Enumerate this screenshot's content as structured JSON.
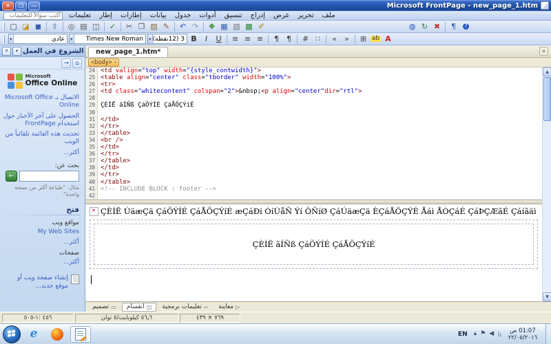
{
  "window": {
    "title": "Microsoft FrontPage - new_page_1.htm",
    "controls": {
      "close": "✕",
      "maximize": "❐",
      "minimize": "—"
    }
  },
  "icons": {
    "dropdown": "▾",
    "scroll_up": "▲",
    "scroll_down": "▼",
    "close": "✕",
    "home": "⌂",
    "back": "→",
    "go_arrow": "←"
  },
  "menu_bar": {
    "question_placeholder": "اكتب سؤالاً للتعليمات",
    "items": [
      {
        "label": "تعليمات"
      },
      {
        "label": "إطار"
      },
      {
        "label": "إطارات"
      },
      {
        "label": "بيانات"
      },
      {
        "label": "جدول"
      },
      {
        "label": "أدوات"
      },
      {
        "label": "تنسيق"
      },
      {
        "label": "إدراج"
      },
      {
        "label": "عرض"
      },
      {
        "label": "تحرير"
      },
      {
        "label": "ملف"
      }
    ]
  },
  "toolbar_standard": [
    {
      "n": "new-page-icon",
      "g": "▢",
      "c": "#4a4a4a"
    },
    {
      "n": "open-folder-icon",
      "g": "◪",
      "c": "#c8931c"
    },
    {
      "n": "save-icon",
      "g": "◼",
      "c": "#3a5fae",
      "sep": true
    },
    {
      "n": "publish-site-icon",
      "g": "⇧",
      "c": "#3a5fae",
      "sep": true
    },
    {
      "n": "search-icon",
      "g": "◎",
      "c": "#555555"
    },
    {
      "n": "print-icon",
      "g": "▤",
      "c": "#555555"
    },
    {
      "n": "print-preview-icon",
      "g": "◫",
      "c": "#555555",
      "sep": true
    },
    {
      "n": "spelling-icon",
      "g": "✓",
      "c": "#2e7d32",
      "sep": true
    },
    {
      "n": "cut-icon",
      "g": "✂",
      "c": "#555555"
    },
    {
      "n": "copy-icon",
      "g": "❐",
      "c": "#555555"
    },
    {
      "n": "paste-icon",
      "g": "▨",
      "c": "#8a6d3b"
    },
    {
      "n": "format-painter-icon",
      "g": "✎",
      "c": "#a05a2c",
      "sep": true
    },
    {
      "n": "undo-icon",
      "g": "↶",
      "c": "#2a56c6"
    },
    {
      "n": "redo-icon",
      "g": "↷",
      "c": "#8a9ab8",
      "sep": true
    },
    {
      "n": "web-component-icon",
      "g": "❖",
      "c": "#2a8a2a"
    },
    {
      "n": "insert-table-icon",
      "g": "▦",
      "c": "#3a5fae"
    },
    {
      "n": "insert-layer-icon",
      "g": "▧",
      "c": "#777777"
    },
    {
      "n": "insert-picture-icon",
      "g": "▩",
      "c": "#2a8a2a"
    },
    {
      "n": "drawing-icon",
      "g": "✐",
      "c": "#b8860b",
      "gap": 200
    },
    {
      "n": "hyperlink-icon",
      "g": "◍",
      "c": "#2a56c6"
    },
    {
      "n": "refresh-icon",
      "g": "↻",
      "c": "#2e7d32"
    },
    {
      "n": "stop-icon",
      "g": "✖",
      "c": "#c0392b",
      "sep": true
    },
    {
      "n": "show-all-icon",
      "g": "¶",
      "c": "#3a5fae"
    },
    {
      "n": "help-icon",
      "g": "?",
      "c": "#ffffff",
      "bg": "#2a56c6",
      "round": true
    }
  ],
  "toolbar_formatting": {
    "style_value": "عادي",
    "font_value": "Times New Roman",
    "size_value": "3 (12نقطة)",
    "icons": [
      {
        "n": "bold-icon",
        "g": "B",
        "c": "#333333",
        "b": true
      },
      {
        "n": "italic-icon",
        "g": "I",
        "c": "#333333",
        "i": true
      },
      {
        "n": "underline-icon",
        "g": "U",
        "c": "#333333",
        "u": true,
        "sep": true
      },
      {
        "n": "align-right-icon",
        "g": "≡",
        "c": "#444444"
      },
      {
        "n": "align-center-icon",
        "g": "≡",
        "c": "#444444"
      },
      {
        "n": "align-left-icon",
        "g": "≡",
        "c": "#444444",
        "sep": true
      },
      {
        "n": "rtl-paragraph-icon",
        "g": "¶",
        "c": "#444444"
      },
      {
        "n": "ltr-paragraph-icon",
        "g": "¶",
        "c": "#444444",
        "sep": true
      },
      {
        "n": "numbering-icon",
        "g": "#",
        "c": "#444444"
      },
      {
        "n": "bullets-icon",
        "g": "∷",
        "c": "#444444",
        "sep": true
      },
      {
        "n": "decrease-indent-icon",
        "g": "«",
        "c": "#444444"
      },
      {
        "n": "increase-indent-icon",
        "g": "»",
        "c": "#444444",
        "sep": true
      },
      {
        "n": "borders-icon",
        "g": "⊞",
        "c": "#444444"
      },
      {
        "n": "highlight-icon",
        "g": "ab",
        "c": "#333333",
        "bg": "#ffe34d"
      },
      {
        "n": "font-color-icon",
        "g": "A",
        "c": "#cc2222",
        "b": true
      }
    ]
  },
  "editor": {
    "tab_label": "new_page_1.htm*",
    "quick_tag": "<body>",
    "code_lines": [
      {
        "n": "24",
        "tokens": [
          [
            "t",
            "<td "
          ],
          [
            "a",
            "valign"
          ],
          [
            "p",
            "="
          ],
          [
            "v",
            "\"top\""
          ],
          [
            "p",
            " "
          ],
          [
            "a",
            "width"
          ],
          [
            "p",
            "="
          ],
          [
            "v",
            "\"{style_contwidth}\""
          ],
          [
            "t",
            ">"
          ]
        ]
      },
      {
        "n": "25",
        "tokens": [
          [
            "t",
            "<table "
          ],
          [
            "a",
            "align"
          ],
          [
            "p",
            "="
          ],
          [
            "v",
            "\"center\""
          ],
          [
            "p",
            " "
          ],
          [
            "a",
            "class"
          ],
          [
            "p",
            "="
          ],
          [
            "v",
            "\"tborder\""
          ],
          [
            "p",
            " "
          ],
          [
            "a",
            "width"
          ],
          [
            "p",
            "="
          ],
          [
            "v",
            "\"100%\""
          ],
          [
            "t",
            ">"
          ]
        ]
      },
      {
        "n": "26",
        "tokens": [
          [
            "t",
            "<tr>"
          ]
        ]
      },
      {
        "n": "27",
        "tokens": [
          [
            "t",
            "<td "
          ],
          [
            "a",
            "class"
          ],
          [
            "p",
            "="
          ],
          [
            "v",
            "\"whitecontent\""
          ],
          [
            "p",
            " "
          ],
          [
            "a",
            "colspan"
          ],
          [
            "p",
            "="
          ],
          [
            "v",
            "\"2\""
          ],
          [
            "t",
            ">"
          ],
          [
            "x",
            "&nbsp;"
          ],
          [
            "t",
            "<p "
          ],
          [
            "a",
            "align"
          ],
          [
            "p",
            "="
          ],
          [
            "v",
            "\"center\""
          ],
          [
            "a",
            "dir"
          ],
          [
            "p",
            "="
          ],
          [
            "v",
            "\"rtl\""
          ],
          [
            "t",
            ">"
          ]
        ]
      },
      {
        "n": "28",
        "tokens": []
      },
      {
        "n": "29",
        "tokens": [
          [
            "x",
            "ÇÈÍË ãÍÑß ÇáÕÝÍÉ ÇáÅÖÇÝíÉ"
          ]
        ]
      },
      {
        "n": "30",
        "tokens": []
      },
      {
        "n": "31",
        "tokens": [
          [
            "t",
            "</td>"
          ]
        ]
      },
      {
        "n": "32",
        "tokens": [
          [
            "t",
            "</tr>"
          ]
        ]
      },
      {
        "n": "33",
        "tokens": [
          [
            "t",
            "</table>"
          ]
        ]
      },
      {
        "n": "34",
        "tokens": [
          [
            "t",
            "<br />"
          ]
        ]
      },
      {
        "n": "35",
        "tokens": [
          [
            "t",
            "</td>"
          ]
        ]
      },
      {
        "n": "36",
        "tokens": [
          [
            "t",
            "</tr>"
          ]
        ]
      },
      {
        "n": "37",
        "tokens": [
          [
            "t",
            "</table>"
          ]
        ]
      },
      {
        "n": "38",
        "tokens": [
          [
            "t",
            "</td>"
          ]
        ]
      },
      {
        "n": "39",
        "tokens": [
          [
            "t",
            "</tr>"
          ]
        ]
      },
      {
        "n": "40",
        "tokens": [
          [
            "t",
            "</table>"
          ]
        ]
      },
      {
        "n": "41",
        "tokens": [
          [
            "c",
            "<!-- INCLUDE BLOCK : footer -->"
          ]
        ]
      },
      {
        "n": "42",
        "tokens": []
      }
    ],
    "design": {
      "paragraph_text": "ÇÈÍË ÚäæÇä ÇáÕÝÍÉ ÇáÅÖÇÝíÉ æÇáÐí ÓíÙåÑ Ýí ÔÑíØ ÇáÚäæÇä ÈÇáÅÖÇÝÉ Åáì ÅÒÇáÉ ÇáÞÇÆãÉ Çáíãäì",
      "centered_text": "ÇÈÍË ãÍÑß ÇáÕÝÍÉ ÇáÅÖÇÝíÉ"
    },
    "view_tabs": [
      {
        "label": "تصميم",
        "name": "design",
        "glyph": "▭"
      },
      {
        "label": "انقسام",
        "name": "split",
        "glyph": "◫",
        "active": true
      },
      {
        "label": "تعليمات برمجية",
        "name": "code",
        "glyph": "‹›"
      },
      {
        "label": "معاينة",
        "name": "preview",
        "glyph": "▷"
      }
    ]
  },
  "task_pane": {
    "title": "الشروع في العمل",
    "office_online_small": "Microsoft",
    "office_online_large": "Office Online",
    "logo_colors": [
      "#e2574c",
      "#7fba42",
      "#4a90d9",
      "#f5c23d"
    ],
    "links": [
      "الاتصال بـ Microsoft Office Online",
      "الحصول على آخر الأخبار حول استخدام FrontPage",
      "تحديث هذه القائمة تلقائياً من الويب",
      "أكثر..."
    ],
    "search_label": "بحث عن:",
    "search_example": "مثال: \"طباعة أكثر من نسخة واحدة\"",
    "open_title": "فتح",
    "open_groups": [
      {
        "label": "مواقع ويب",
        "links": [
          "My Web Sites",
          "أكثر..."
        ]
      },
      {
        "label": "صفحات",
        "links": [
          "أكثر..."
        ]
      }
    ],
    "create_link": "إنشاء صفحة ويب أو موقع جديد..."
  },
  "status_bar": {
    "segments": [
      "٤٥٦ :١-٥٠٥",
      "٥٦٫٦ كيلوبايت/٥ ثوان",
      "٧٦٩ × ٤٣٩"
    ]
  },
  "taskbar": {
    "language": "EN",
    "time": "01:07 ص",
    "date": "٢٢/٠٥/٢٠١٦",
    "tray_icons": [
      {
        "n": "hidden-icons-chevron",
        "g": "▴"
      },
      {
        "n": "action-center-icon",
        "g": "⚑"
      },
      {
        "n": "volume-icon",
        "g": "◀"
      },
      {
        "n": "network-icon",
        "g": "⣦"
      }
    ]
  }
}
